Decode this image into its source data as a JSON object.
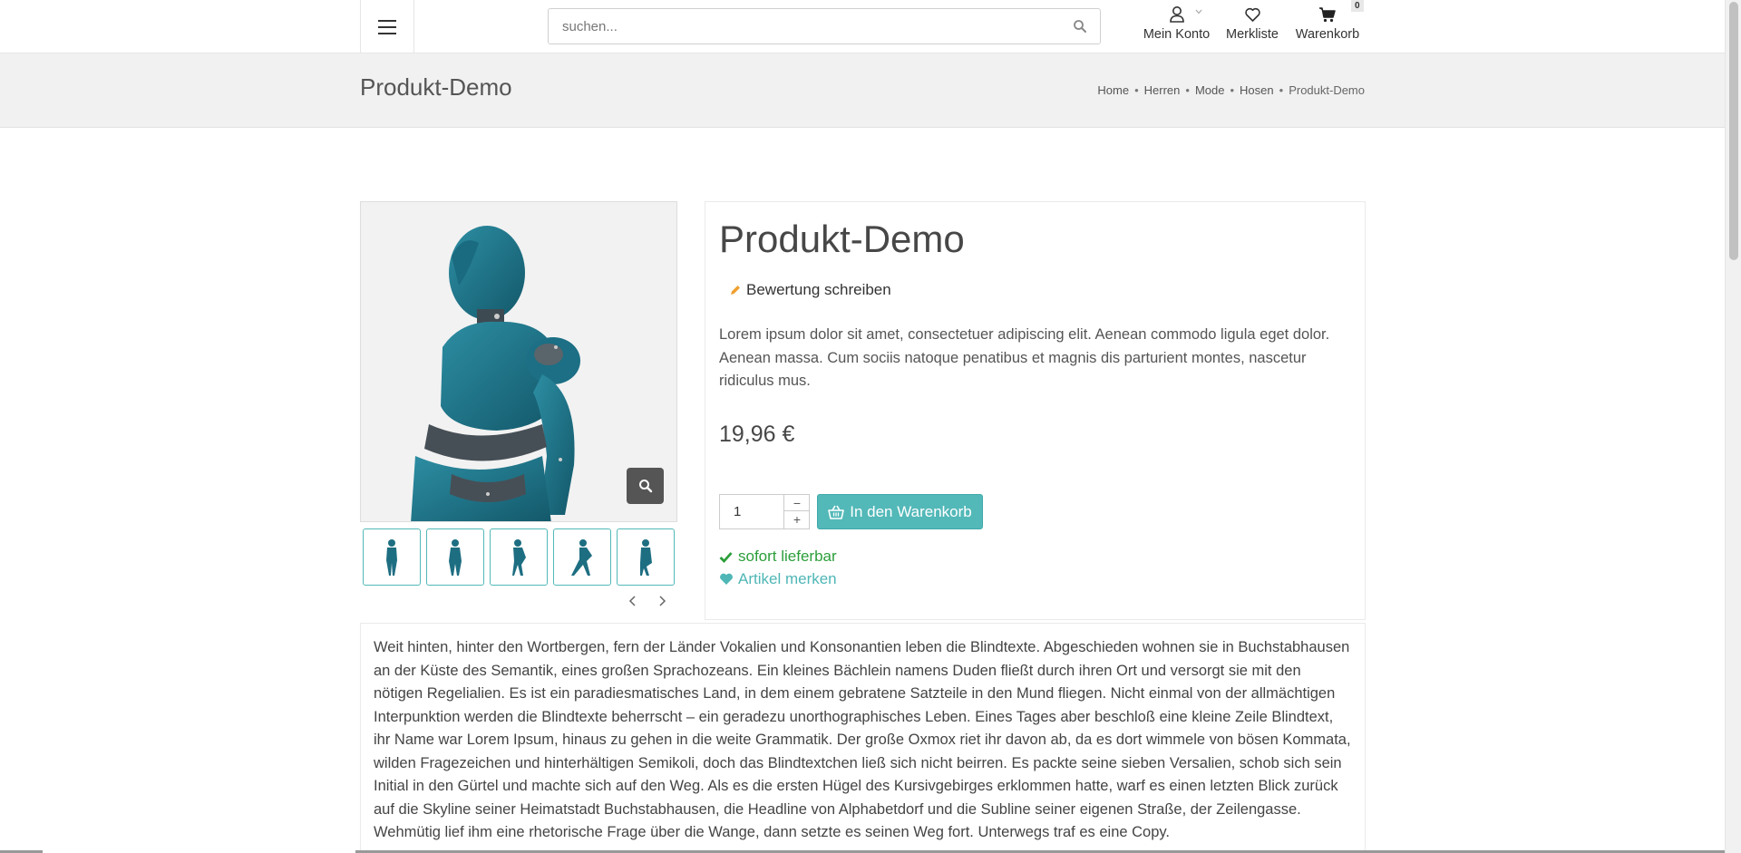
{
  "header": {
    "menu_icon": "hamburger-menu-icon",
    "search": {
      "placeholder": "suchen...",
      "value": "",
      "icon": "search-icon"
    },
    "account_label": "Mein Konto",
    "wishlist_label": "Merkliste",
    "cart_label": "Warenkorb",
    "cart_count": "0"
  },
  "titlebar": {
    "title": "Produkt-Demo",
    "breadcrumb": [
      "Home",
      "Herren",
      "Mode",
      "Hosen",
      "Produkt-Demo"
    ]
  },
  "gallery": {
    "main_image": "robot-figure-image",
    "zoom_icon": "search-icon",
    "thumbnail_count": 5
  },
  "product": {
    "title": "Produkt-Demo",
    "review_link": "Bewertung schreiben",
    "short_description": "Lorem ipsum dolor sit amet, consectetuer adipiscing elit. Aenean commodo ligula eget dolor. Aenean massa. Cum sociis natoque penatibus et magnis dis parturient montes, nascetur ridiculus mus.",
    "price": "19,96 €",
    "quantity": "1",
    "qty_minus": "−",
    "qty_plus": "+",
    "add_to_cart_label": "In den Warenkorb",
    "availability": "sofort lieferbar",
    "wishlist_link": "Artikel merken"
  },
  "description": {
    "text": "Weit hinten, hinter den Wortbergen, fern der Länder Vokalien und Konsonantien leben die Blindtexte. Abgeschieden wohnen sie in Buchstabhausen an der Küste des Semantik, eines großen Sprachozeans. Ein kleines Bächlein namens Duden fließt durch ihren Ort und versorgt sie mit den nötigen Regelialien. Es ist ein paradiesmatisches Land, in dem einem gebratene Satzteile in den Mund fliegen. Nicht einmal von der allmächtigen Interpunktion werden die Blindtexte beherrscht – ein geradezu unorthographisches Leben. Eines Tages aber beschloß eine kleine Zeile Blindtext, ihr Name war Lorem Ipsum, hinaus zu gehen in die weite Grammatik. Der große Oxmox riet ihr davon ab, da es dort wimmele von bösen Kommata, wilden Fragezeichen und hinterhältigen Semikoli, doch das Blindtextchen ließ sich nicht beirren. Es packte seine sieben Versalien, schob sich sein Initial in den Gürtel und machte sich auf den Weg. Als es die ersten Hügel des Kursivgebirges erklommen hatte, warf es einen letzten Blick zurück auf die Skyline seiner Heimatstadt Buchstabhausen, die Headline von Alphabetdorf und die Subline seiner eigenen Straße, der Zeilengasse. Wehmütig lief ihm eine rhetorische Frage über die Wange, dann setzte es seinen Weg fort. Unterwegs traf es eine Copy."
  },
  "colors": {
    "accent": "#53b8b8",
    "available": "#2b9e3a",
    "pencil": "#f0a030"
  }
}
